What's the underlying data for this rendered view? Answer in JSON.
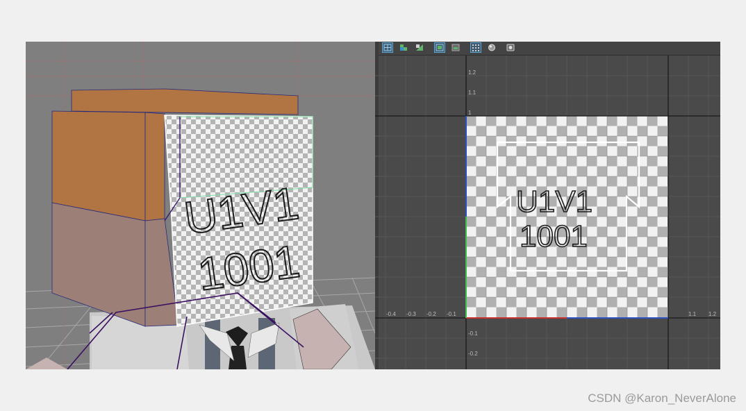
{
  "viewport": {
    "texture_label_line1": "U1V1",
    "texture_label_line2": "1001"
  },
  "uv_editor": {
    "toolbar_icons": [
      "grid-view-icon",
      "uv-shell-icon",
      "checker-split-icon",
      "frame-icon",
      "texture-icon",
      "tile-grid-icon",
      "shading-sphere-icon",
      "snapshot-icon"
    ],
    "texture_label_line1": "U1V1",
    "texture_label_line2": "1001",
    "v_ticks": [
      "1.2",
      "1.1",
      "1",
      "-0.1",
      "-0.2"
    ],
    "u_ticks": [
      "-0.4",
      "-0.3",
      "-0.2",
      "-0.1",
      "1.1",
      "1.2"
    ]
  },
  "watermark": "CSDN @Karon_NeverAlone",
  "colors": {
    "checker_dark": "#b4b4b4",
    "checker_light": "#f2f2f2",
    "hair": "#b07543",
    "face": "#9c8078",
    "uv_axis_u": "#c8302e",
    "uv_axis_v": "#2a7de0"
  }
}
